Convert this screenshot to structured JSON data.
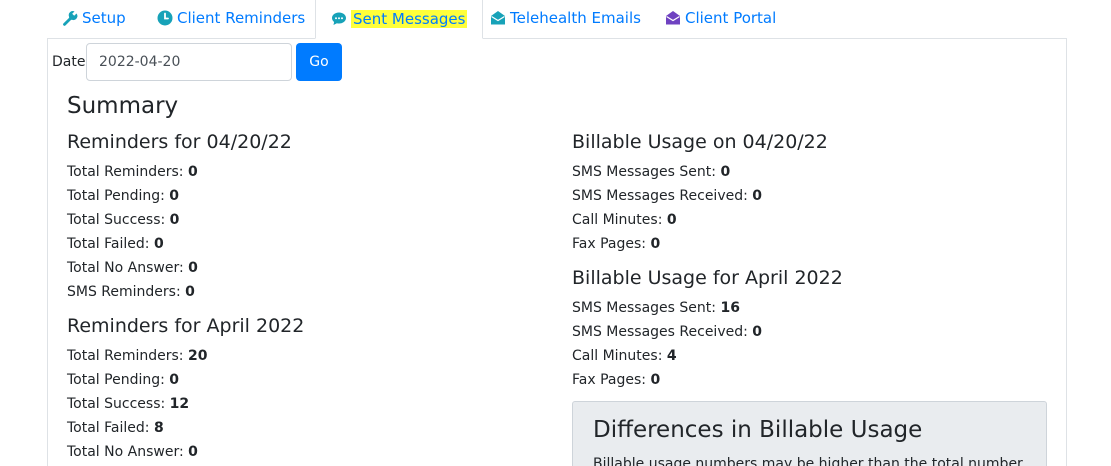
{
  "tabs": [
    {
      "label": "Setup",
      "icon": "wrench-icon"
    },
    {
      "label": "Client Reminders",
      "icon": "clock-icon"
    },
    {
      "label": "Sent Messages",
      "icon": "chat-bubble-icon"
    },
    {
      "label": "Telehealth Emails",
      "icon": "envelope-open-icon"
    },
    {
      "label": "Client Portal",
      "icon": "envelope-open-icon"
    }
  ],
  "active_tab": "Sent Messages",
  "date_filter": {
    "label": "Date",
    "value": "2022-04-20",
    "go_label": "Go"
  },
  "summary": {
    "title": "Summary",
    "reminders_day": {
      "title": "Reminders for 04/20/22",
      "rows": [
        {
          "label": "Total Reminders:",
          "value": "0"
        },
        {
          "label": "Total Pending:",
          "value": "0"
        },
        {
          "label": "Total Success:",
          "value": "0"
        },
        {
          "label": "Total Failed:",
          "value": "0"
        },
        {
          "label": "Total No Answer:",
          "value": "0"
        },
        {
          "label": "SMS Reminders:",
          "value": "0"
        }
      ]
    },
    "reminders_month": {
      "title": "Reminders for April 2022",
      "rows": [
        {
          "label": "Total Reminders:",
          "value": "20"
        },
        {
          "label": "Total Pending:",
          "value": "0"
        },
        {
          "label": "Total Success:",
          "value": "12"
        },
        {
          "label": "Total Failed:",
          "value": "8"
        },
        {
          "label": "Total No Answer:",
          "value": "0"
        }
      ]
    },
    "billable_day": {
      "title": "Billable Usage on 04/20/22",
      "rows": [
        {
          "label": "SMS Messages Sent:",
          "value": "0"
        },
        {
          "label": "SMS Messages Received:",
          "value": "0"
        },
        {
          "label": "Call Minutes:",
          "value": "0"
        },
        {
          "label": "Fax Pages:",
          "value": "0"
        }
      ]
    },
    "billable_month": {
      "title": "Billable Usage for April 2022",
      "rows": [
        {
          "label": "SMS Messages Sent:",
          "value": "16"
        },
        {
          "label": "SMS Messages Received:",
          "value": "0"
        },
        {
          "label": "Call Minutes:",
          "value": "4"
        },
        {
          "label": "Fax Pages:",
          "value": "0"
        }
      ]
    }
  },
  "callout": {
    "title": "Differences in Billable Usage",
    "text": "Billable usage numbers may be higher than the total number"
  },
  "colors": {
    "link": "#007bff",
    "highlight": "#ffff3a",
    "icon_teal": "#17a2b8",
    "icon_purple": "#6f42c1"
  }
}
